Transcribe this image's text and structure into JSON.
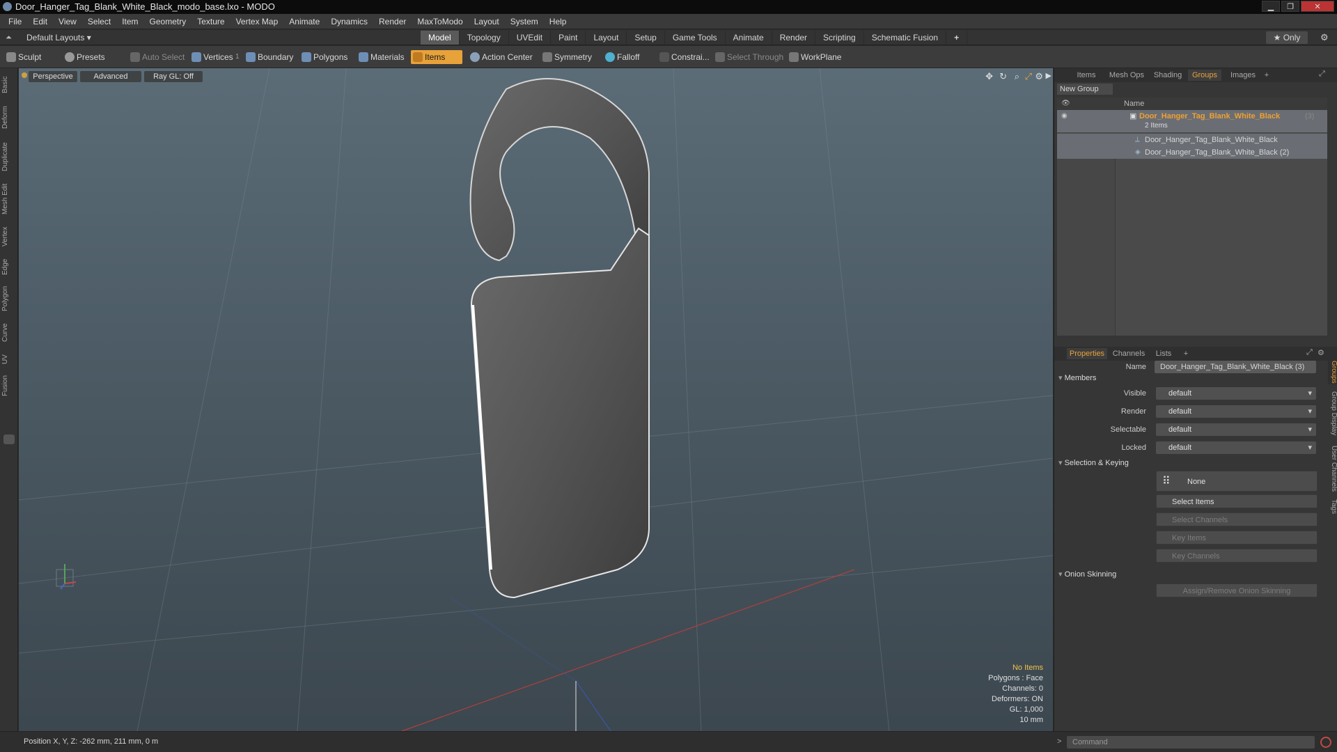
{
  "window": {
    "title": "Door_Hanger_Tag_Blank_White_Black_modo_base.lxo - MODO"
  },
  "menu": [
    "File",
    "Edit",
    "View",
    "Select",
    "Item",
    "Geometry",
    "Texture",
    "Vertex Map",
    "Animate",
    "Dynamics",
    "Render",
    "MaxToModo",
    "Layout",
    "System",
    "Help"
  ],
  "layout": {
    "selector": "Default Layouts ▾",
    "tabs": [
      "Model",
      "Topology",
      "UVEdit",
      "Paint",
      "Layout",
      "Setup",
      "Game Tools",
      "Animate",
      "Render",
      "Scripting",
      "Schematic Fusion",
      "+"
    ],
    "active_tab": "Model",
    "only_button": "★ Only"
  },
  "toolbar": {
    "sculpt": "Sculpt",
    "presets": "Presets",
    "auto_select": "Auto Select",
    "vertices": "Vertices",
    "vertices_count": "1",
    "boundary": "Boundary",
    "polygons": "Polygons",
    "materials": "Materials",
    "items": "Items",
    "action_center": "Action Center",
    "symmetry": "Symmetry",
    "falloff": "Falloff",
    "constrain": "Constrai...",
    "select_through": "Select Through",
    "workplane": "WorkPlane"
  },
  "left_tabs": [
    "Basic",
    "Deform",
    "Duplicate",
    "Mesh Edit",
    "Vertex",
    "Edge",
    "Polygon",
    "Curve",
    "UV",
    "Fusion"
  ],
  "viewport": {
    "view_mode": "Perspective",
    "shading": "Advanced",
    "raygl": "Ray GL: Off",
    "info": {
      "items": "No Items",
      "polygons": "Polygons : Face",
      "channels": "Channels: 0",
      "deformers": "Deformers: ON",
      "gl": "GL: 1,000",
      "scale": "10 mm"
    }
  },
  "status": {
    "position": "Position X, Y, Z:  -262 mm, 211 mm, 0 m",
    "command_placeholder": "Command"
  },
  "upper_panel": {
    "tabs": [
      "Items",
      "Mesh Ops",
      "Shading",
      "Groups",
      "Images",
      "+"
    ],
    "active_tab": "Groups",
    "new_group": "New Group",
    "column_name": "Name",
    "group": {
      "name": "Door_Hanger_Tag_Blank_White_Black",
      "count": "(3)",
      "sub": "2 Items"
    },
    "members": [
      "Door_Hanger_Tag_Blank_White_Black",
      "Door_Hanger_Tag_Blank_White_Black (2)"
    ]
  },
  "properties": {
    "tabs": [
      "Properties",
      "Channels",
      "Lists",
      "+"
    ],
    "active_tab": "Properties",
    "name_label": "Name",
    "name_value": "Door_Hanger_Tag_Blank_White_Black (3)",
    "members_section": "Members",
    "visible_label": "Visible",
    "visible_value": "default",
    "render_label": "Render",
    "render_value": "default",
    "selectable_label": "Selectable",
    "selectable_value": "default",
    "locked_label": "Locked",
    "locked_value": "default",
    "selection_section": "Selection & Keying",
    "none_button": "None",
    "select_items": "Select Items",
    "select_channels": "Select Channels",
    "key_items": "Key Items",
    "key_channels": "Key Channels",
    "onion_section": "Onion Skinning",
    "onion_button": "Assign/Remove Onion Skinning",
    "side_tabs": [
      "Groups",
      "Group Display",
      "User Channels",
      "Tags"
    ]
  }
}
